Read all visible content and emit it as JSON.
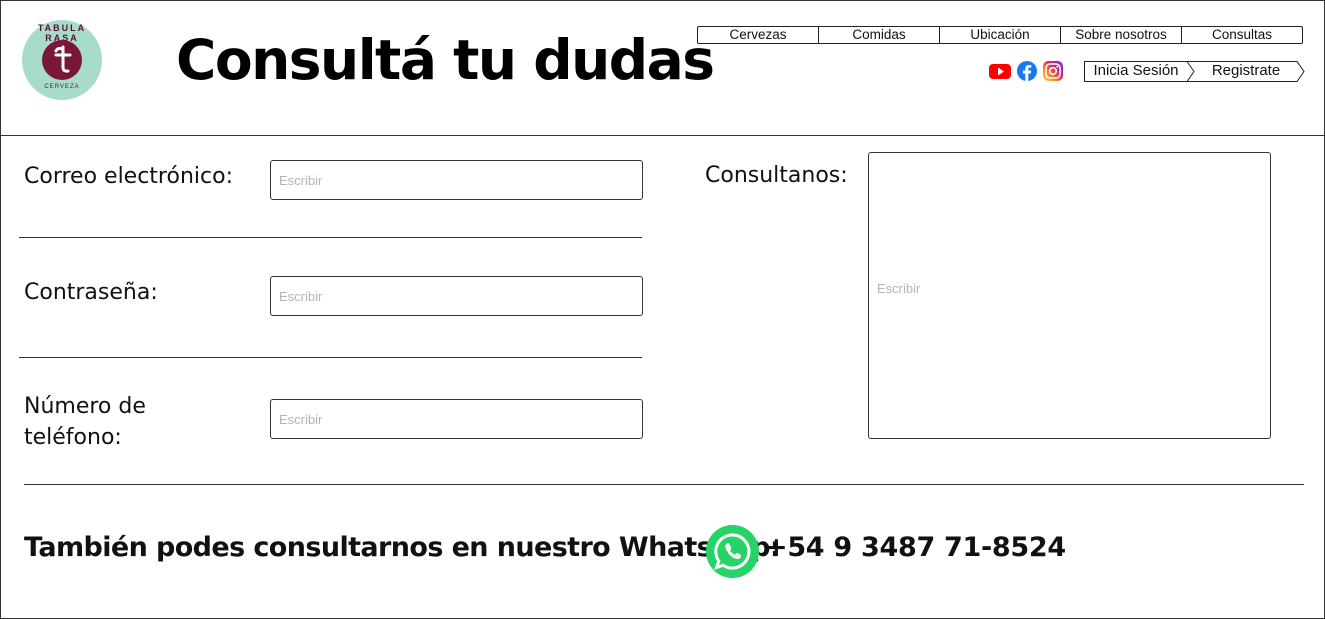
{
  "header": {
    "logo": {
      "top_text": "TABULA RASA",
      "bottom_text": "CERVEZA"
    },
    "title": "Consultá tu dudas",
    "nav": [
      "Cervezas",
      "Comidas",
      "Ubicación",
      "Sobre nosotros",
      "Consultas"
    ],
    "social": [
      "youtube-icon",
      "facebook-icon",
      "instagram-icon"
    ],
    "auth": {
      "login": "Inicia Sesión",
      "register": "Registrate"
    }
  },
  "form": {
    "email": {
      "label": "Correo electrónico:",
      "placeholder": "Escribir",
      "value": ""
    },
    "password": {
      "label": "Contraseña:",
      "placeholder": "Escribir",
      "value": ""
    },
    "phone": {
      "label_line1": "Número de",
      "label_line2": "teléfono:",
      "placeholder": "Escribir",
      "value": ""
    },
    "message": {
      "label": "Consultanos:",
      "placeholder": "Escribir",
      "value": ""
    }
  },
  "whatsapp": {
    "text": "También podes consultarnos en nuestro WhatsApp:",
    "phone": "+54 9 3487 71-8524"
  },
  "colors": {
    "logo_bg": "#a7dccd",
    "logo_accent": "#7a1638",
    "whatsapp_green": "#25d366",
    "youtube_red": "#ff0000",
    "facebook_blue": "#1877f2"
  }
}
